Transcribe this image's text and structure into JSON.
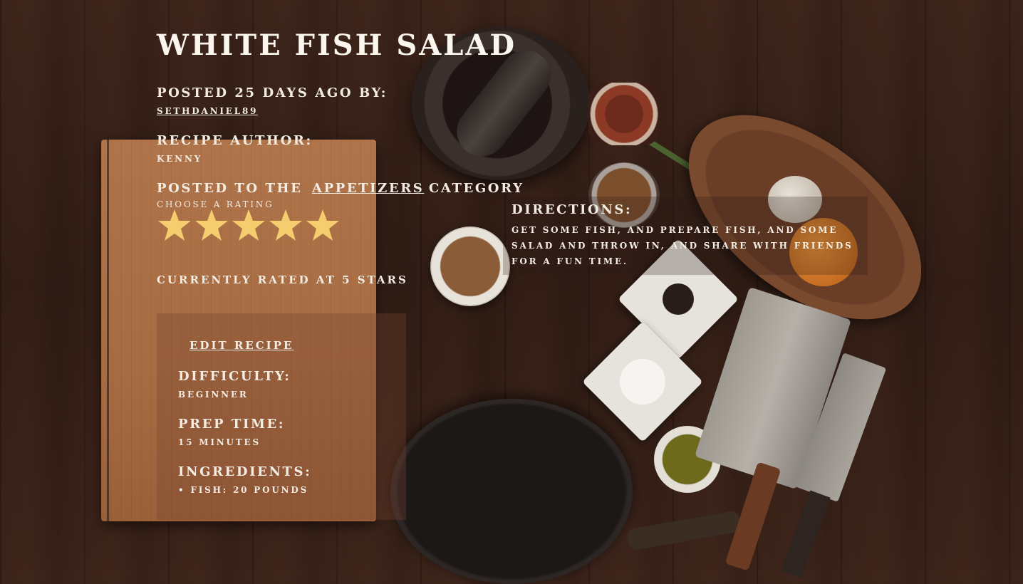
{
  "recipe": {
    "title": "WHITE FISH SALAD",
    "posted_label": "POSTED 25 DAYS AGO BY:",
    "posted_by": "SETHDANIEL89",
    "author_label": "RECIPE AUTHOR:",
    "author": "KENNY",
    "posted_to_prefix": "POSTED TO THE",
    "category": "APPETIZERS",
    "posted_to_suffix": "CATEGORY",
    "choose_rating_label": "CHOOSE A RATING",
    "rating_stars": 5,
    "rating_max": 5,
    "star_color": "#f5cd6e",
    "currently_rated": "CURRENTLY RATED AT 5 STARS"
  },
  "details": {
    "edit_label": "EDIT RECIPE",
    "difficulty_label": "DIFFICULTY:",
    "difficulty": "BEGINNER",
    "prep_time_label": "PREP TIME:",
    "prep_time": "15 MINUTES",
    "ingredients_label": "INGREDIENTS:",
    "ingredients": [
      "• FISH: 20 POUNDS"
    ]
  },
  "directions": {
    "label": "DIRECTIONS:",
    "lines": [
      "GET SOME FISH, AND PREPARE FISH, AND SOME",
      "SALAD AND THROW IN, AND SHARE WITH FRIENDS",
      "FOR A FUN TIME."
    ]
  }
}
